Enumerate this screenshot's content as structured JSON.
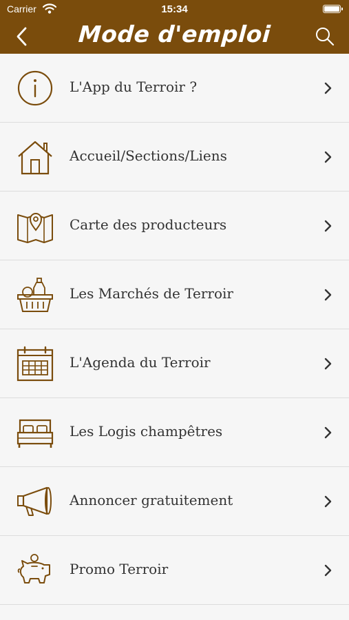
{
  "status_bar": {
    "carrier": "Carrier",
    "time": "15:34"
  },
  "header": {
    "title": "Mode d'emploi",
    "back_icon": "chevron-left-icon",
    "search_icon": "search-icon",
    "background": "#7a4c0c"
  },
  "accent_color": "#7a4c0c",
  "menu": {
    "items": [
      {
        "label": "L'App du Terroir ?",
        "icon": "info-icon"
      },
      {
        "label": "Accueil/Sections/Liens",
        "icon": "home-icon"
      },
      {
        "label": "Carte des producteurs",
        "icon": "map-pin-icon"
      },
      {
        "label": "Les Marchés de Terroir",
        "icon": "basket-icon"
      },
      {
        "label": "L'Agenda du Terroir",
        "icon": "calendar-icon"
      },
      {
        "label": "Les Logis champêtres",
        "icon": "bed-icon"
      },
      {
        "label": "Annoncer gratuitement",
        "icon": "megaphone-icon"
      },
      {
        "label": "Promo Terroir",
        "icon": "piggy-bank-icon"
      }
    ]
  }
}
